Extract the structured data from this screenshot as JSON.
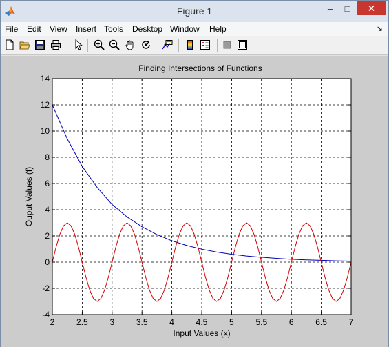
{
  "window": {
    "title": "Figure 1"
  },
  "titlebar": {
    "minimize_glyph": "–",
    "maximize_glyph": "□",
    "close_glyph": "✕"
  },
  "menu": {
    "items": [
      "File",
      "Edit",
      "View",
      "Insert",
      "Tools",
      "Desktop",
      "Window",
      "Help"
    ],
    "overflow_glyph": "↘"
  },
  "toolbar": {
    "icons": [
      "new-figure-icon",
      "open-file-icon",
      "save-icon",
      "print-icon",
      "edit-plot-arrow-icon",
      "zoom-in-icon",
      "zoom-out-icon",
      "pan-hand-icon",
      "rotate-3d-icon",
      "data-cursor-icon",
      "insert-colorbar-icon",
      "insert-legend-icon",
      "hide-plot-tools-icon",
      "show-plot-tools-icon"
    ]
  },
  "colors": {
    "series_exp": "#0000b4",
    "series_sin": "#d40000",
    "axes_bg": "#ffffff",
    "figure_bg": "#cccccc",
    "close_button": "#c7372f"
  },
  "chart_data": {
    "type": "line",
    "title": "Finding Intersections of Functions",
    "xlabel": "Input Values (x)",
    "ylabel": "Ouput Values (f)",
    "xlim": [
      2,
      7
    ],
    "ylim": [
      -4,
      14
    ],
    "xticks": [
      2,
      2.5,
      3,
      3.5,
      4,
      4.5,
      5,
      5.5,
      6,
      6.5,
      7
    ],
    "xtick_labels": [
      "2",
      "2.5",
      "3",
      "3.5",
      "4",
      "4.5",
      "5",
      "5.5",
      "6",
      "6.5",
      "7"
    ],
    "yticks": [
      -4,
      -2,
      0,
      2,
      4,
      6,
      8,
      10,
      12,
      14
    ],
    "ytick_labels": [
      "-4",
      "-2",
      "0",
      "2",
      "4",
      "6",
      "8",
      "10",
      "12",
      "14"
    ],
    "grid": true,
    "grid_style": "dashed",
    "series": [
      {
        "color": "#0000b4",
        "x": [
          2.0,
          2.25,
          2.5,
          2.75,
          3.0,
          3.25,
          3.5,
          3.75,
          4.0,
          4.25,
          4.5,
          4.75,
          5.0,
          5.25,
          5.5,
          5.75,
          6.0,
          6.25,
          6.5,
          6.75,
          7.0
        ],
        "y": [
          12.0,
          9.4,
          7.3,
          5.7,
          4.4,
          3.45,
          2.7,
          2.1,
          1.63,
          1.27,
          0.99,
          0.77,
          0.6,
          0.47,
          0.37,
          0.29,
          0.22,
          0.17,
          0.14,
          0.1,
          0.08
        ]
      },
      {
        "color": "#d40000",
        "x": [
          2.0,
          2.0625,
          2.125,
          2.1875,
          2.25,
          2.3125,
          2.375,
          2.4375,
          2.5,
          2.5625,
          2.625,
          2.6875,
          2.75,
          2.8125,
          2.875,
          2.9375,
          3.0,
          3.0625,
          3.125,
          3.1875,
          3.25,
          3.3125,
          3.375,
          3.4375,
          3.5,
          3.5625,
          3.625,
          3.6875,
          3.75,
          3.8125,
          3.875,
          3.9375,
          4.0,
          4.0625,
          4.125,
          4.1875,
          4.25,
          4.3125,
          4.375,
          4.4375,
          4.5,
          4.5625,
          4.625,
          4.6875,
          4.75,
          4.8125,
          4.875,
          4.9375,
          5.0,
          5.0625,
          5.125,
          5.1875,
          5.25,
          5.3125,
          5.375,
          5.4375,
          5.5,
          5.5625,
          5.625,
          5.6875,
          5.75,
          5.8125,
          5.875,
          5.9375,
          6.0,
          6.0625,
          6.125,
          6.1875,
          6.25,
          6.3125,
          6.375,
          6.4375,
          6.5,
          6.5625,
          6.625,
          6.6875,
          6.75,
          6.8125,
          6.875,
          6.9375,
          7.0
        ],
        "y": [
          0.0,
          1.15,
          2.12,
          2.77,
          3.0,
          2.77,
          2.12,
          1.15,
          0.0,
          -1.15,
          -2.12,
          -2.77,
          -3.0,
          -2.77,
          -2.12,
          -1.15,
          0.0,
          1.15,
          2.12,
          2.77,
          3.0,
          2.77,
          2.12,
          1.15,
          0.0,
          -1.15,
          -2.12,
          -2.77,
          -3.0,
          -2.77,
          -2.12,
          -1.15,
          0.0,
          1.15,
          2.12,
          2.77,
          3.0,
          2.77,
          2.12,
          1.15,
          0.0,
          -1.15,
          -2.12,
          -2.77,
          -3.0,
          -2.77,
          -2.12,
          -1.15,
          0.0,
          1.15,
          2.12,
          2.77,
          3.0,
          2.77,
          2.12,
          1.15,
          0.0,
          -1.15,
          -2.12,
          -2.77,
          -3.0,
          -2.77,
          -2.12,
          -1.15,
          0.0,
          1.15,
          2.12,
          2.77,
          3.0,
          2.77,
          2.12,
          1.15,
          0.0,
          -1.15,
          -2.12,
          -2.77,
          -3.0,
          -2.77,
          -2.12,
          -1.15,
          0.0
        ]
      }
    ]
  }
}
